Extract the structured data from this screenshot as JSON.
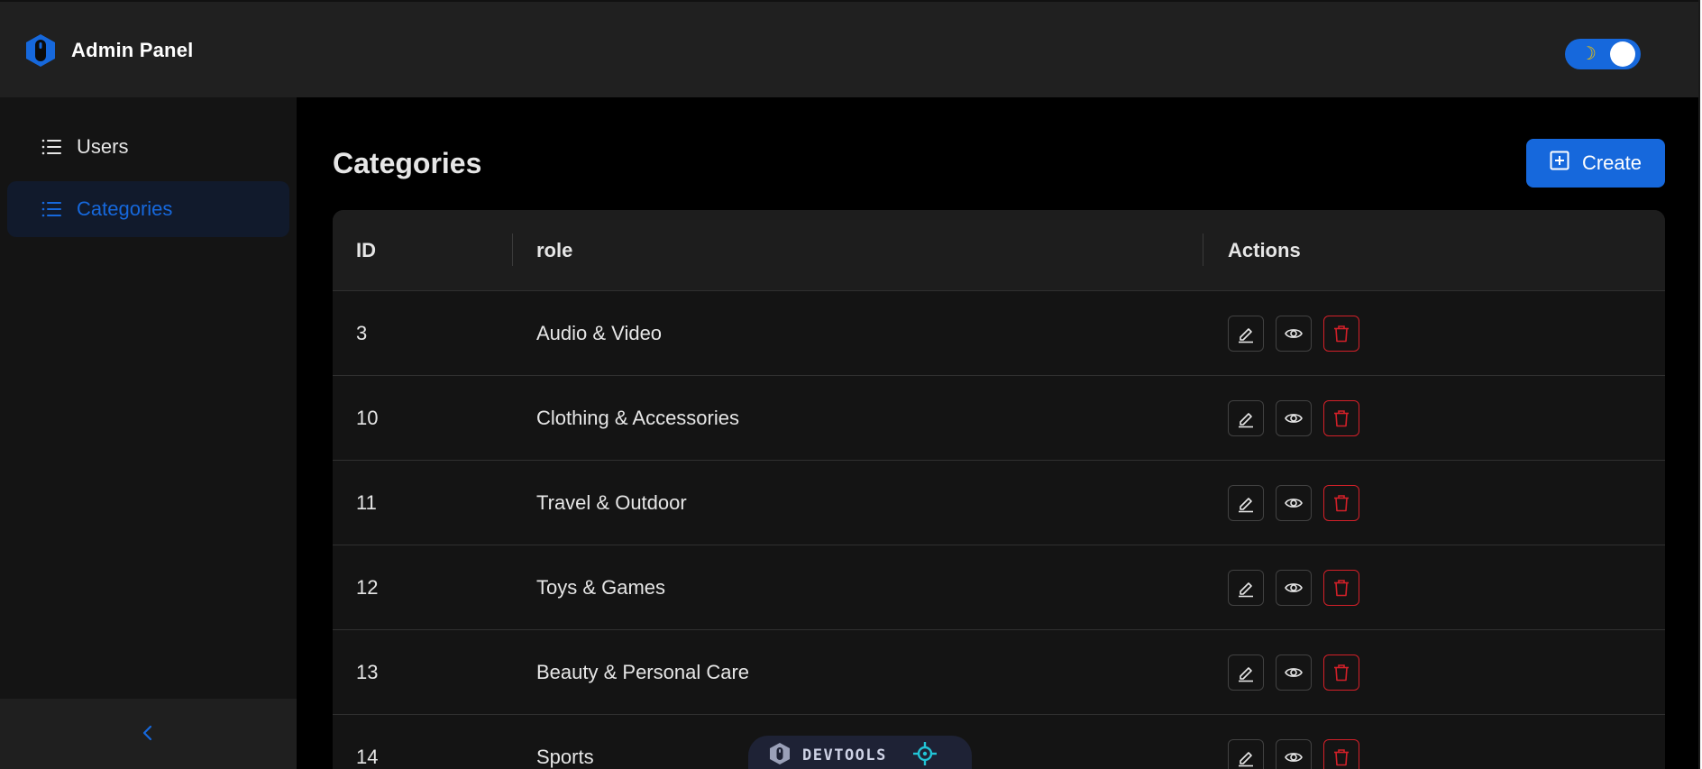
{
  "header": {
    "title": "Admin Panel",
    "theme_icon": "moon-icon",
    "accent": "#1668dc"
  },
  "sidebar": {
    "items": [
      {
        "label": "Users",
        "icon": "list-icon",
        "active": false
      },
      {
        "label": "Categories",
        "icon": "list-icon",
        "active": true
      }
    ],
    "collapse_icon": "chevron-left-icon"
  },
  "main": {
    "title": "Categories",
    "create_label": "Create",
    "table": {
      "columns": [
        "ID",
        "role",
        "Actions"
      ],
      "rows": [
        {
          "id": "3",
          "name": "Audio & Video"
        },
        {
          "id": "10",
          "name": "Clothing & Accessories"
        },
        {
          "id": "11",
          "name": "Travel & Outdoor"
        },
        {
          "id": "12",
          "name": "Toys & Games"
        },
        {
          "id": "13",
          "name": "Beauty & Personal Care"
        },
        {
          "id": "14",
          "name": "Sports"
        }
      ],
      "row_actions": [
        "edit-icon",
        "eye-icon",
        "trash-icon"
      ]
    }
  },
  "devtools": {
    "label": "DEVTOOLS"
  },
  "colors": {
    "danger": "#d32029",
    "background": "#000000",
    "sidebar": "#141414",
    "header": "#202020"
  }
}
